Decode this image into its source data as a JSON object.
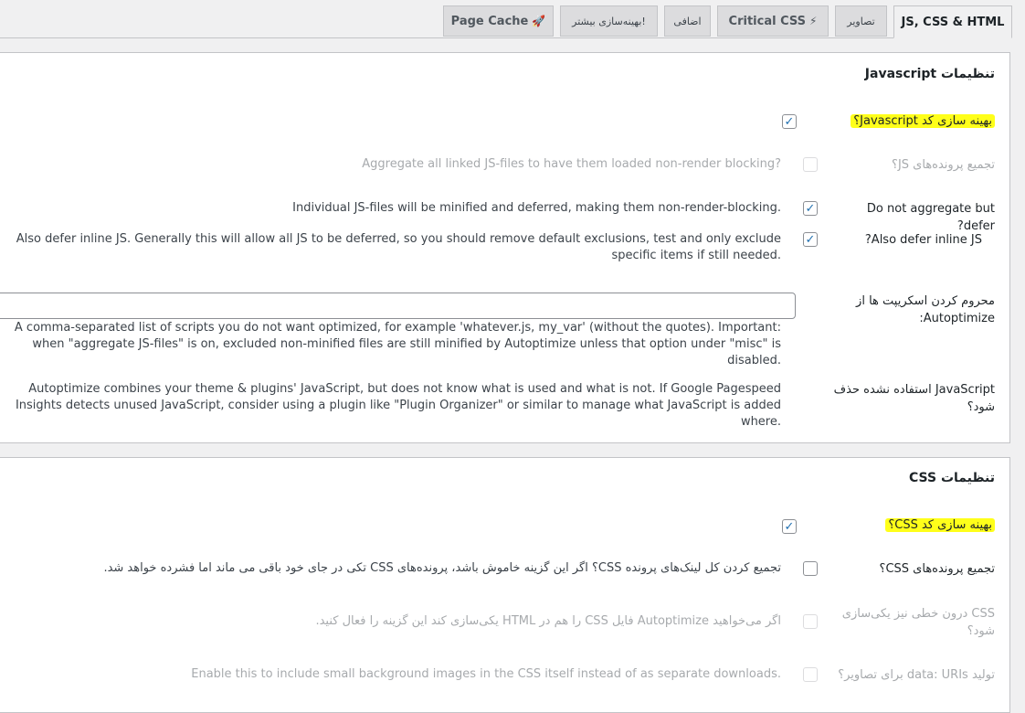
{
  "tabs": [
    {
      "label": "JS, CSS & HTML",
      "active": true
    },
    {
      "label": "تصاویر"
    },
    {
      "label": "Critical CSS",
      "emoji": "⚡"
    },
    {
      "label": "اضافی"
    },
    {
      "label": "بهینه‌سازی بیشتر!"
    },
    {
      "label": "Page Cache",
      "emoji": "🚀"
    }
  ],
  "js_panel": {
    "title": "تنظیمات Javascript",
    "optimize_js": {
      "label": "بهینه سازی کد Javascript؟",
      "checked": true
    },
    "aggregate_js": {
      "label": "تجمیع پرونده‌های JS؟",
      "desc": "Aggregate all linked JS-files to have them loaded non-render blocking?",
      "checked": false
    },
    "defer": {
      "label": "Do not aggregate but defer?",
      "desc": "Individual JS-files will be minified and deferred, making them non-render-blocking.",
      "checked": true
    },
    "defer_inline": {
      "label": "Also defer inline JS?",
      "desc": "Also defer inline JS. Generally this will allow all JS to be deferred, so you should remove default exclusions, test and only exclude specific items if still needed.",
      "checked": true
    },
    "exclude": {
      "label": "محروم کردن اسکریپت ها از Autoptimize:",
      "value": "",
      "desc": "A comma-separated list of scripts you do not want optimized, for example 'whatever.js, my_var' (without the quotes). Important: when \"aggregate JS-files\" is on, excluded non-minified files are still minified by Autoptimize unless that option under \"misc\" is disabled."
    },
    "unused": {
      "label": "JavaScript استفاده نشده حذف شود؟",
      "desc": "Autoptimize combines your theme & plugins' JavaScript, but does not know what is used and what is not. If Google Pagespeed Insights detects unused JavaScript, consider using a plugin like \"Plugin Organizer\" or similar to manage what JavaScript is added where."
    }
  },
  "css_panel": {
    "title": "تنظیمات CSS",
    "optimize_css": {
      "label": "بهینه سازی کد CSS؟",
      "checked": true
    },
    "aggregate_css": {
      "label": "تجمیع پرونده‌های CSS؟",
      "desc": "تجمیع کردن کل لینک‌های پرونده CSS؟ اگر این گزینه خاموش باشد، پرونده‌های CSS تکی در جای خود باقی می ماند اما فشرده خواهد شد.",
      "checked": false
    },
    "inline_css": {
      "label": "CSS درون خطی نیز یکی‌سازی شود؟",
      "desc": "اگر می‌خواهید Autoptimize فایل CSS را هم در HTML یکی‌سازی کند این گزینه را فعال کنید.",
      "checked": false
    },
    "data_uris": {
      "label": "تولید data: URIs برای تصاویر؟",
      "desc": "Enable this to include small background images in the CSS itself instead of as separate downloads.",
      "checked": false
    }
  },
  "icons": {
    "check": "check-icon"
  },
  "colors": {
    "highlight": "#ffff1a",
    "check": "#2271b1"
  }
}
